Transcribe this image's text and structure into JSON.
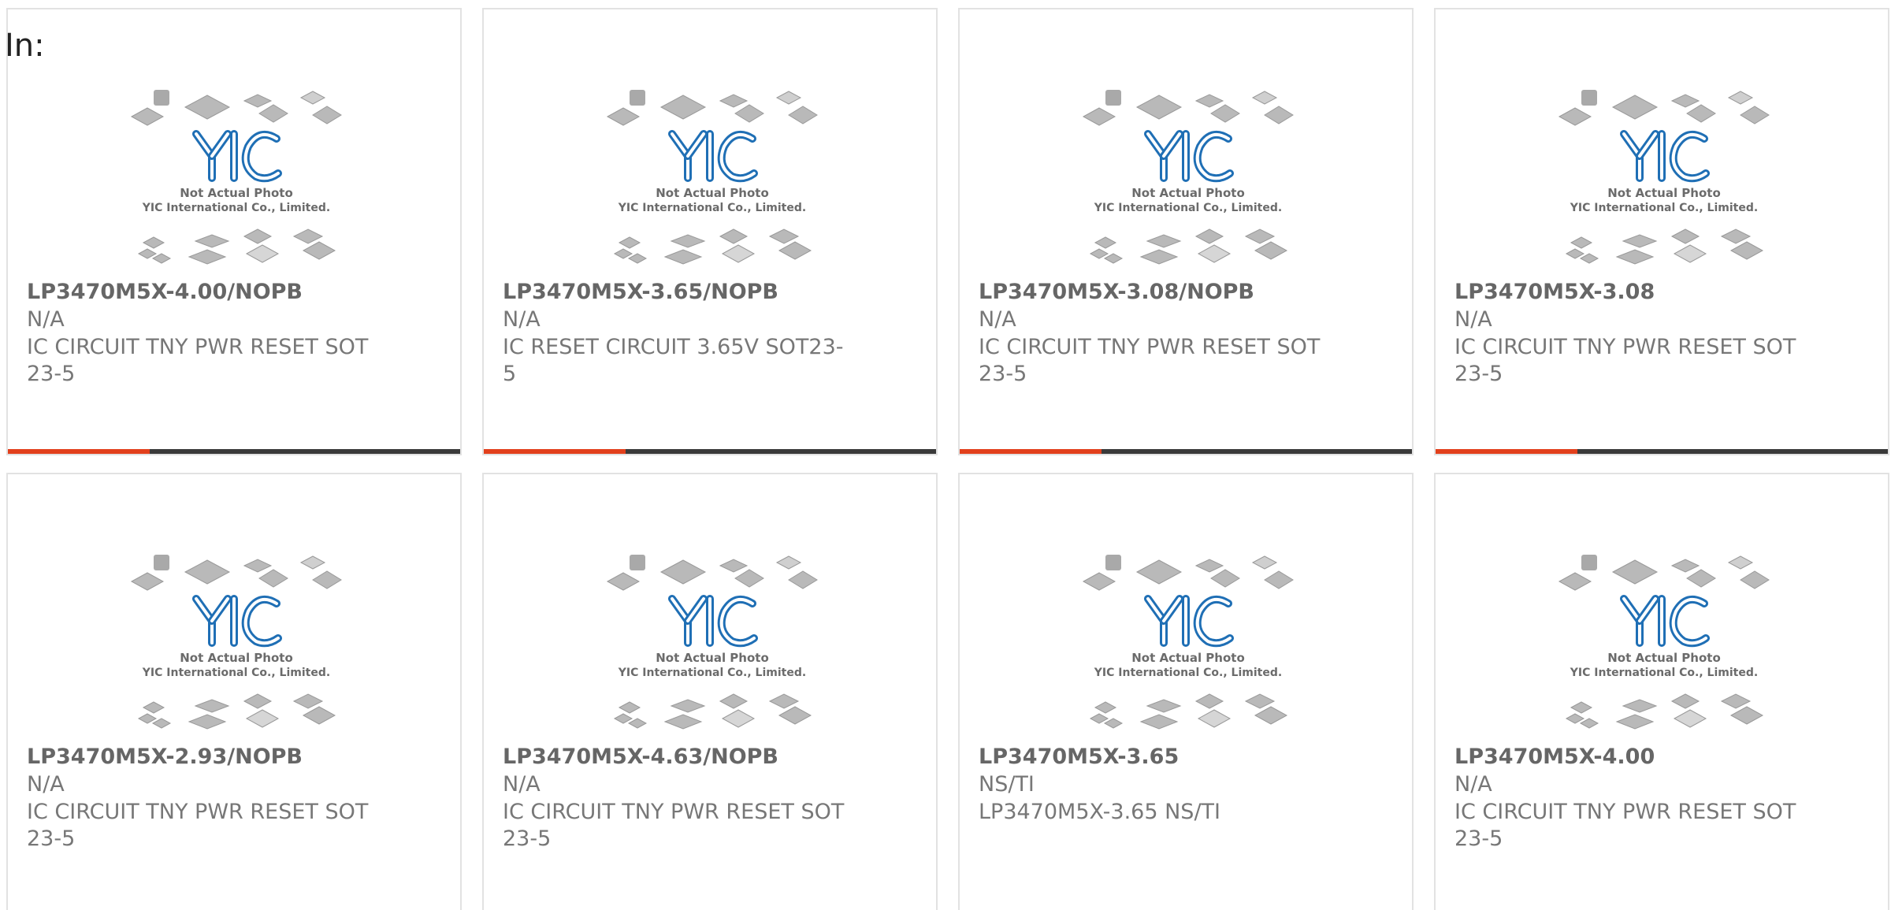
{
  "header": {
    "label": "In:"
  },
  "photo": {
    "caption_line1": "Not Actual Photo",
    "caption_line2": "YIC International Co., Limited.",
    "logo_text": "YIC",
    "logo_color": "#1f6fb5"
  },
  "colors": {
    "accent": "#e2401c",
    "bar": "#3a3a3a"
  },
  "products": [
    {
      "part_number": "LP3470M5X-4.00/NOPB",
      "manufacturer": "N/A",
      "description": "IC CIRCUIT TNY PWR RESET SOT23-5"
    },
    {
      "part_number": "LP3470M5X-3.65/NOPB",
      "manufacturer": "N/A",
      "description": "IC RESET CIRCUIT 3.65V SOT23-5"
    },
    {
      "part_number": "LP3470M5X-3.08/NOPB",
      "manufacturer": "N/A",
      "description": "IC CIRCUIT TNY PWR RESET SOT23-5"
    },
    {
      "part_number": "LP3470M5X-3.08",
      "manufacturer": "N/A",
      "description": "IC CIRCUIT TNY PWR RESET SOT23-5"
    },
    {
      "part_number": "LP3470M5X-2.93/NOPB",
      "manufacturer": "N/A",
      "description": "IC CIRCUIT TNY PWR RESET SOT23-5"
    },
    {
      "part_number": "LP3470M5X-4.63/NOPB",
      "manufacturer": "N/A",
      "description": "IC CIRCUIT TNY PWR RESET SOT23-5"
    },
    {
      "part_number": "LP3470M5X-3.65",
      "manufacturer": "NS/TI",
      "description": "LP3470M5X-3.65 NS/TI"
    },
    {
      "part_number": "LP3470M5X-4.00",
      "manufacturer": "N/A",
      "description": "IC CIRCUIT TNY PWR RESET SOT23-5"
    }
  ]
}
